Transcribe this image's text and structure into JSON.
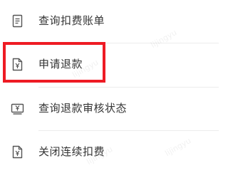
{
  "menu": {
    "items": [
      {
        "label": "查询扣费账单",
        "icon": "bill-list-icon"
      },
      {
        "label": "申请退款",
        "icon": "refund-document-icon"
      },
      {
        "label": "查询退款审核状态",
        "icon": "refund-status-icon"
      },
      {
        "label": "关闭连续扣费",
        "icon": "cancel-autopay-icon"
      }
    ]
  },
  "watermark": {
    "text": "lijingyu"
  },
  "colors": {
    "highlight": "#ee1b24",
    "text": "#333333",
    "icon": "#555555"
  }
}
